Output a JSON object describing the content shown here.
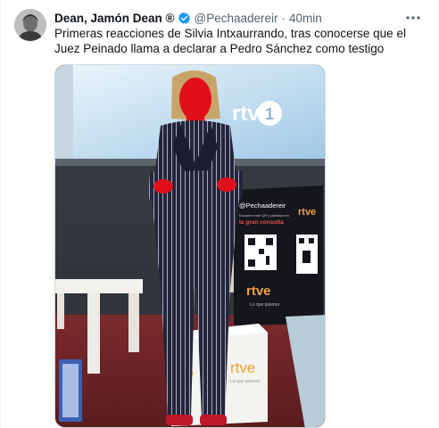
{
  "tweet": {
    "author_name": "Dean, Jamón Dean ®",
    "handle": "@Pechaadereir",
    "separator": "·",
    "time": "40min",
    "more_icon": "more-dots-icon",
    "verified_icon": "verified-badge-icon",
    "verified_color": "#1d9bf0",
    "text": "Primeras reacciones de Silvia Intxaurrando, tras conocerse que el Juez Peinado llama a declarar a Pedro Sánchez como testigo"
  },
  "image": {
    "watermark_handle": "@Pechaadereir",
    "stand_brand": "rtve",
    "stand_tagline": "la gran consulta",
    "stand_slogan": "Lo que quieres",
    "stand_prompt": "Escanea este QR y participa en",
    "cube_brand": "rtve",
    "cube_tagline": "La que quieres",
    "screen_brand": "rtve",
    "screen_number": "1"
  }
}
